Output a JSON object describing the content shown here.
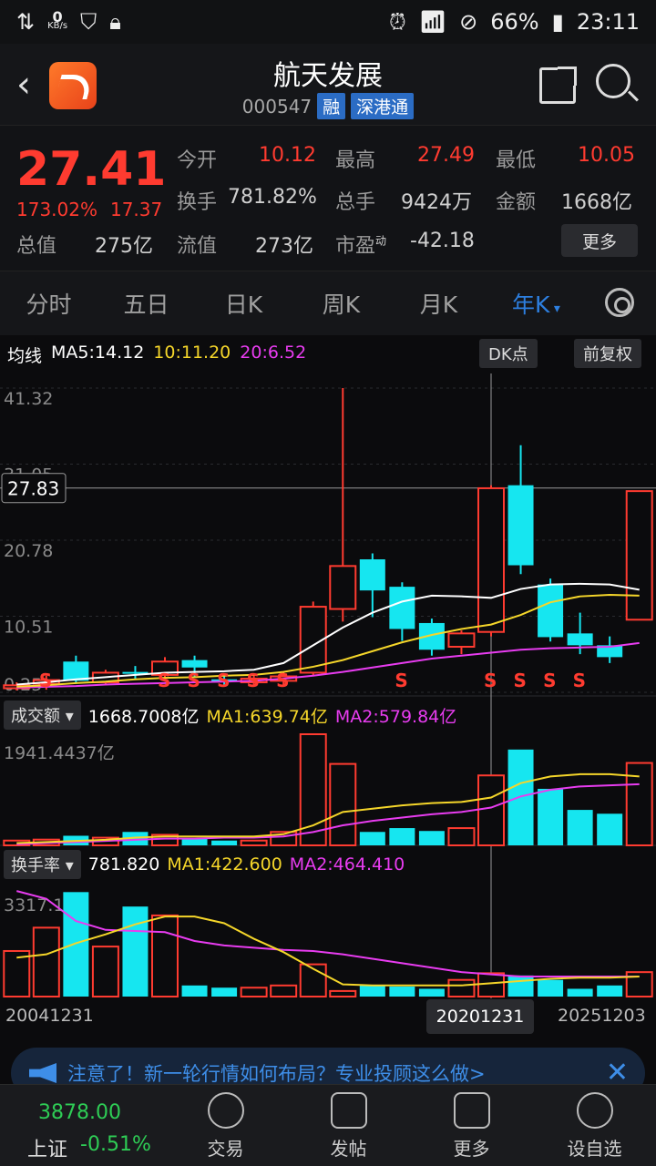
{
  "status_bar": {
    "speed_value": "0",
    "speed_unit": "KB/s",
    "battery": "66%",
    "time": "23:11"
  },
  "header": {
    "title": "航天发展",
    "code": "000547",
    "tags": [
      "融",
      "深港通"
    ]
  },
  "quote": {
    "price": "27.41",
    "change_pct": "173.02%",
    "change_abs": "17.37",
    "fields": [
      {
        "label": "今开",
        "value": "10.12",
        "color": "red"
      },
      {
        "label": "最高",
        "value": "27.49",
        "color": "red"
      },
      {
        "label": "最低",
        "value": "10.05",
        "color": "red"
      },
      {
        "label": "换手",
        "value": "781.82%"
      },
      {
        "label": "总手",
        "value": "9424万"
      },
      {
        "label": "金额",
        "value": "1668亿"
      },
      {
        "label": "总值",
        "value": "275亿"
      },
      {
        "label": "流值",
        "value": "273亿"
      },
      {
        "label": "市盈",
        "sup": "动",
        "value": "-42.18"
      }
    ],
    "more_button": "更多"
  },
  "tabs": [
    "分时",
    "五日",
    "日K",
    "周K",
    "月K",
    "年K"
  ],
  "active_tab": "年K",
  "ma_bar": {
    "label": "均线",
    "ma5": "MA5:14.12",
    "ma10": "10:11.20",
    "ma20": "20:6.52",
    "dk_button": "DK点",
    "adjust_button": "前复权"
  },
  "volume_bar": {
    "selector": "成交额",
    "value": "1668.7008亿",
    "ma1": "MA1:639.74亿",
    "ma2": "MA2:579.84亿",
    "axis_max": "1941.4437亿"
  },
  "turnover_bar": {
    "selector": "换手率",
    "value": "781.820",
    "ma1": "MA1:422.600",
    "ma2": "MA2:464.410",
    "axis_max": "3317.190"
  },
  "dates": {
    "start": "20041231",
    "cursor": "20201231",
    "end": "20251203"
  },
  "notice": {
    "text": "注意了！新一轮行情如何布局？专业投顾这么做>"
  },
  "bottom": {
    "index_name": "上证",
    "index_value": "3878.00",
    "index_change": "-0.51%",
    "items": [
      "交易",
      "发帖",
      "更多",
      "设自选"
    ]
  },
  "colors": {
    "up": "#ff3b30",
    "down": "#16e6f0",
    "ma5": "#ffffff",
    "ma10": "#f5d62a",
    "ma20": "#e83cf0",
    "accent": "#2d7fe0"
  },
  "chart_data": {
    "type": "candlestick",
    "y_ticks": [
      "41.32",
      "31.05",
      "20.78",
      "10.51",
      "0.25"
    ],
    "crosshair_price": "27.83",
    "candles": [
      {
        "open": 0.8,
        "close": 1.2,
        "low": 0.5,
        "high": 1.6,
        "up": true
      },
      {
        "open": 1.4,
        "close": 1.9,
        "low": 0.6,
        "high": 2.5,
        "up": true
      },
      {
        "open": 4.4,
        "close": 1.8,
        "low": 1.4,
        "high": 5.2,
        "up": false
      },
      {
        "open": 1.6,
        "close": 2.9,
        "low": 1.2,
        "high": 3.3,
        "up": true
      },
      {
        "open": 2.9,
        "close": 3.0,
        "low": 2.0,
        "high": 3.8,
        "up": false
      },
      {
        "open": 2.6,
        "close": 4.4,
        "low": 2.2,
        "high": 5.0,
        "up": true
      },
      {
        "open": 3.6,
        "close": 4.6,
        "low": 2.4,
        "high": 5.2,
        "up": false
      },
      {
        "open": 1.8,
        "close": 2.0,
        "low": 1.2,
        "high": 2.4,
        "up": false
      },
      {
        "open": 1.6,
        "close": 2.1,
        "low": 1.0,
        "high": 2.6,
        "up": true
      },
      {
        "open": 1.8,
        "close": 2.4,
        "low": 1.2,
        "high": 3.0,
        "up": true
      },
      {
        "open": 2.9,
        "close": 11.8,
        "low": 2.4,
        "high": 12.5,
        "up": true
      },
      {
        "open": 11.5,
        "close": 17.3,
        "low": 9.8,
        "high": 41.32,
        "up": true
      },
      {
        "open": 18.2,
        "close": 14.0,
        "low": 10.4,
        "high": 19.0,
        "up": false
      },
      {
        "open": 14.5,
        "close": 8.8,
        "low": 7.2,
        "high": 15.1,
        "up": false
      },
      {
        "open": 9.6,
        "close": 6.0,
        "low": 5.2,
        "high": 10.2,
        "up": false
      },
      {
        "open": 6.4,
        "close": 8.2,
        "low": 5.4,
        "high": 8.6,
        "up": true
      },
      {
        "open": 8.4,
        "close": 27.8,
        "low": 7.8,
        "high": 28.2,
        "up": true
      },
      {
        "open": 28.2,
        "close": 17.4,
        "low": 16.2,
        "high": 33.6,
        "up": false
      },
      {
        "open": 14.8,
        "close": 7.7,
        "low": 7.1,
        "high": 15.6,
        "up": false
      },
      {
        "open": 8.2,
        "close": 6.6,
        "low": 5.4,
        "high": 11.0,
        "up": false
      },
      {
        "open": 6.6,
        "close": 5.0,
        "low": 4.2,
        "high": 7.8,
        "up": false
      },
      {
        "open": 10.05,
        "close": 27.41,
        "low": 10.05,
        "high": 27.49,
        "up": true
      }
    ],
    "ma5": [
      1.3,
      1.6,
      2.0,
      2.3,
      2.6,
      2.9,
      3.0,
      3.1,
      3.3,
      4.2,
      6.6,
      9.0,
      11.0,
      12.5,
      13.3,
      13.2,
      13.0,
      14.2,
      14.8,
      14.9,
      14.8,
      14.1
    ],
    "ma10": [
      1.0,
      1.2,
      1.5,
      1.7,
      2.0,
      2.2,
      2.3,
      2.5,
      2.6,
      3.0,
      3.7,
      4.6,
      5.8,
      7.0,
      8.0,
      8.8,
      9.4,
      10.7,
      12.4,
      13.2,
      13.4,
      13.3
    ],
    "ma20": [
      0.9,
      1.0,
      1.1,
      1.3,
      1.4,
      1.5,
      1.6,
      1.7,
      1.8,
      2.1,
      2.5,
      3.0,
      3.6,
      4.2,
      4.8,
      5.2,
      5.6,
      6.0,
      6.2,
      6.3,
      6.4,
      6.9
    ],
    "signals": [
      1,
      5,
      6,
      7,
      8,
      9,
      13,
      16,
      17,
      18,
      19
    ],
    "volume": [
      0.05,
      0.06,
      0.1,
      0.08,
      0.14,
      0.11,
      0.07,
      0.05,
      0.05,
      0.14,
      1.16,
      0.85,
      0.14,
      0.18,
      0.15,
      0.18,
      0.73,
      1.0,
      0.59,
      0.37,
      0.33,
      0.86
    ],
    "volume_ma1": [
      0.02,
      0.03,
      0.04,
      0.05,
      0.07,
      0.08,
      0.08,
      0.08,
      0.08,
      0.1,
      0.18,
      0.3,
      0.33,
      0.36,
      0.38,
      0.39,
      0.43,
      0.56,
      0.62,
      0.64,
      0.64,
      0.62
    ],
    "volume_ma2": [
      0.01,
      0.02,
      0.03,
      0.04,
      0.05,
      0.06,
      0.06,
      0.07,
      0.07,
      0.08,
      0.12,
      0.18,
      0.22,
      0.25,
      0.28,
      0.3,
      0.34,
      0.44,
      0.5,
      0.53,
      0.54,
      0.55
    ],
    "turnover": [
      0.41,
      0.62,
      0.94,
      0.45,
      0.81,
      0.73,
      0.1,
      0.08,
      0.08,
      0.1,
      0.29,
      0.05,
      0.1,
      0.09,
      0.07,
      0.15,
      0.21,
      0.19,
      0.15,
      0.07,
      0.1,
      0.22
    ],
    "turnover_ma1": [
      0.35,
      0.38,
      0.48,
      0.56,
      0.65,
      0.72,
      0.72,
      0.66,
      0.52,
      0.4,
      0.25,
      0.11,
      0.1,
      0.1,
      0.1,
      0.1,
      0.12,
      0.14,
      0.16,
      0.17,
      0.17,
      0.18
    ],
    "turnover_ma2": [
      0.95,
      0.88,
      0.68,
      0.6,
      0.59,
      0.58,
      0.5,
      0.46,
      0.44,
      0.42,
      0.41,
      0.38,
      0.34,
      0.3,
      0.26,
      0.22,
      0.2,
      0.18,
      0.18,
      0.18,
      0.18,
      0.18
    ]
  }
}
